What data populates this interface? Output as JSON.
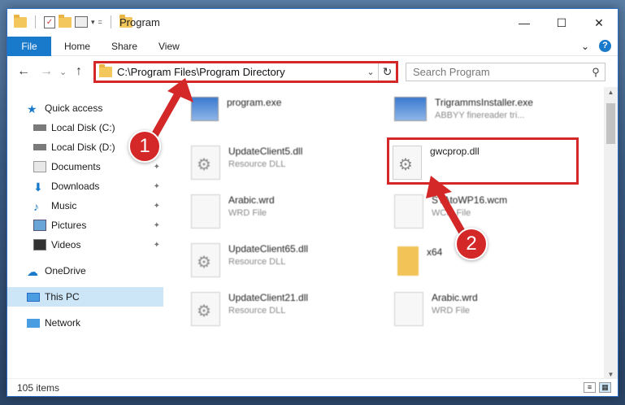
{
  "window": {
    "title": "Program",
    "buttons": {
      "minimize": "—",
      "maximize": "☐",
      "close": "✕"
    }
  },
  "quick_access_toolbar": {
    "dropdown": "▾",
    "customize": "="
  },
  "ribbon": {
    "tabs": [
      "File",
      "Home",
      "Share",
      "View"
    ],
    "collapse_glyph": "⌄",
    "help_glyph": "?"
  },
  "navigation": {
    "back": "←",
    "forward": "→",
    "recent": "⌄",
    "up": "↑",
    "address_path": "C:\\Program Files\\Program Directory",
    "address_dropdown": "⌄",
    "refresh": "↻",
    "search_placeholder": "Search Program",
    "search_icon_glyph": "⚲"
  },
  "sidebar": {
    "items": [
      {
        "label": "Quick access",
        "icon": "star-icon",
        "pinned": false
      },
      {
        "label": "Local Disk (C:)",
        "icon": "drive-icon",
        "pinned": false
      },
      {
        "label": "Local Disk (D:)",
        "icon": "drive-icon",
        "pinned": false
      },
      {
        "label": "Documents",
        "icon": "documents-icon",
        "pinned": true
      },
      {
        "label": "Downloads",
        "icon": "download-icon",
        "pinned": true
      },
      {
        "label": "Music",
        "icon": "music-icon",
        "pinned": true
      },
      {
        "label": "Pictures",
        "icon": "pictures-icon",
        "pinned": true
      },
      {
        "label": "Videos",
        "icon": "videos-icon",
        "pinned": true
      },
      {
        "label": "OneDrive",
        "icon": "cloud-icon",
        "pinned": false
      },
      {
        "label": "This PC",
        "icon": "computer-icon",
        "pinned": false,
        "selected": true
      },
      {
        "label": "Network",
        "icon": "network-icon",
        "pinned": false
      }
    ],
    "pin_glyph": "📌"
  },
  "files": {
    "left_column": [
      {
        "name": "program.exe",
        "type": "",
        "icon": "exe-icon"
      },
      {
        "name": "UpdateClient5.dll",
        "type": "Resource DLL",
        "icon": "dll-icon"
      },
      {
        "name": "Arabic.wrd",
        "type": "WRD File",
        "icon": "file-icon"
      },
      {
        "name": "UpdateClient65.dll",
        "type": "Resource DLL",
        "icon": "dll-icon"
      },
      {
        "name": "UpdateClient21.dll",
        "type": "Resource DLL",
        "icon": "dll-icon"
      }
    ],
    "right_column": [
      {
        "name": "TrigrammsInstaller.exe",
        "type": "ABBYY finereader tri...",
        "icon": "exe-icon"
      },
      {
        "name": "gwcprop.dll",
        "type": "",
        "icon": "dll-icon",
        "highlighted": true
      },
      {
        "name": "STAtoWP16.wcm",
        "type": "WCM File",
        "icon": "file-icon"
      },
      {
        "name": "x64",
        "type": "",
        "icon": "folder-icon"
      },
      {
        "name": "Arabic.wrd",
        "type": "WRD File",
        "icon": "file-icon"
      }
    ]
  },
  "status_bar": {
    "item_count": "105 items"
  },
  "callouts": [
    {
      "label": "1"
    },
    {
      "label": "2"
    }
  ],
  "colors": {
    "accent": "#1979ca",
    "highlight_red": "#d42828",
    "selected_bg": "#cde6f7"
  }
}
